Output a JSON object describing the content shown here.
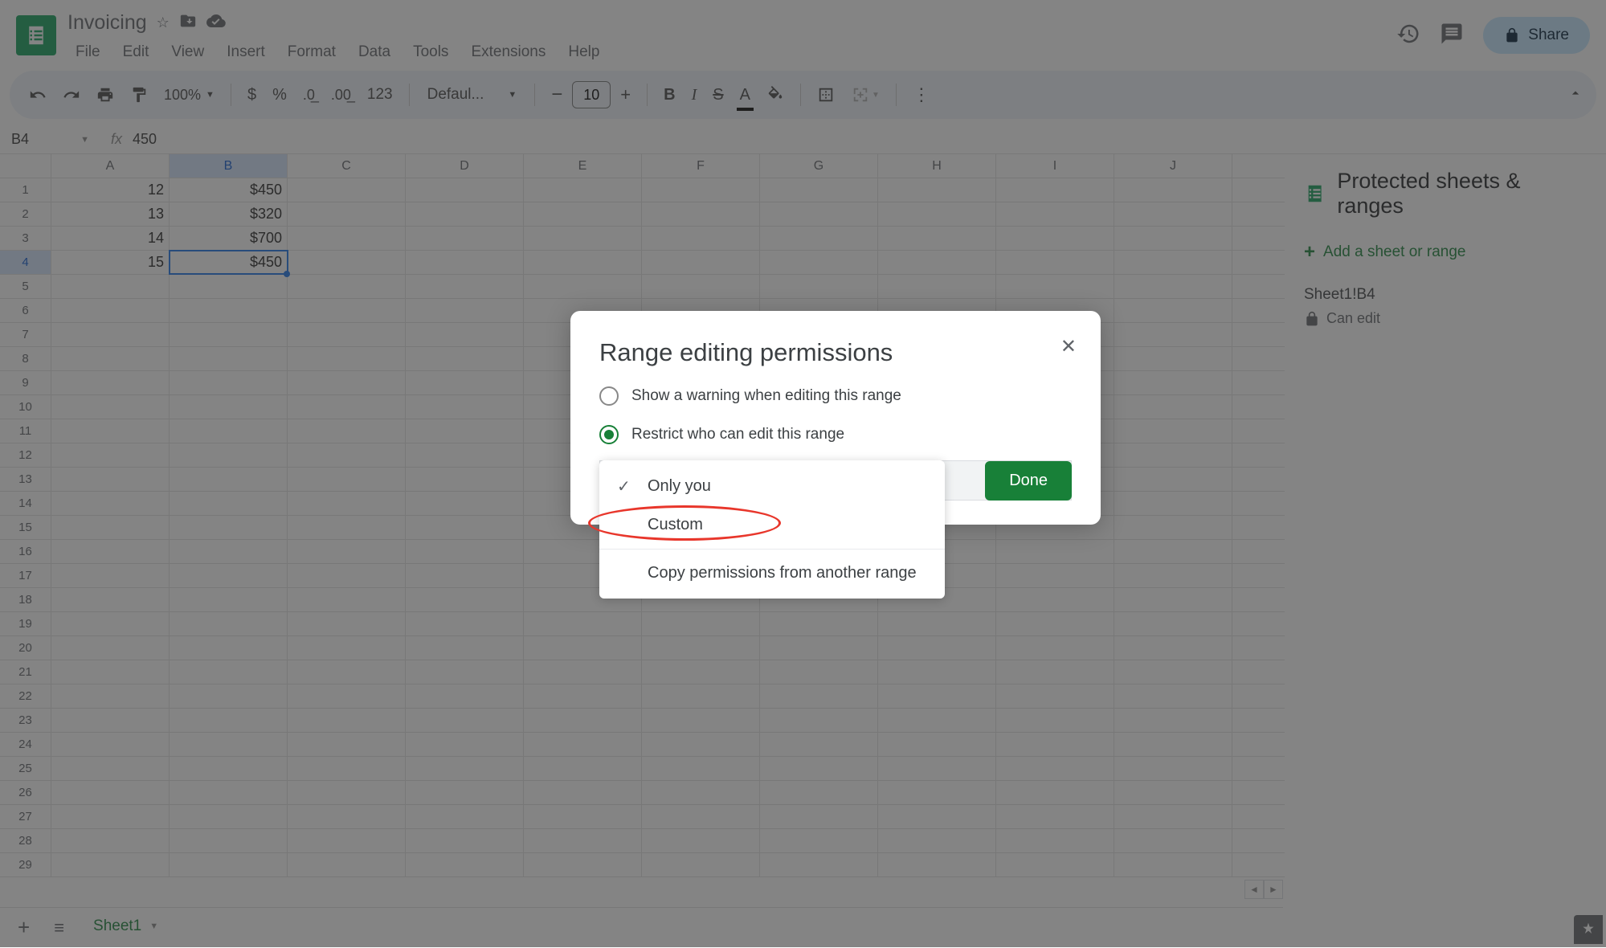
{
  "header": {
    "doc_title": "Invoicing",
    "menus": [
      "File",
      "Edit",
      "View",
      "Insert",
      "Format",
      "Data",
      "Tools",
      "Extensions",
      "Help"
    ],
    "share": "Share"
  },
  "toolbar": {
    "zoom": "100%",
    "font": "Defaul...",
    "font_size": "10",
    "number_format": "123"
  },
  "fx": {
    "name_box": "B4",
    "value": "450"
  },
  "grid": {
    "columns": [
      "A",
      "B",
      "C",
      "D",
      "E",
      "F",
      "G",
      "H",
      "I",
      "J"
    ],
    "rows": [
      {
        "n": 1,
        "a": "12",
        "b": "$450"
      },
      {
        "n": 2,
        "a": "13",
        "b": "$320"
      },
      {
        "n": 3,
        "a": "14",
        "b": "$700"
      },
      {
        "n": 4,
        "a": "15",
        "b": "$450",
        "sel": true
      },
      {
        "n": 5
      },
      {
        "n": 6
      },
      {
        "n": 7
      },
      {
        "n": 8
      },
      {
        "n": 9
      },
      {
        "n": 10
      },
      {
        "n": 11
      },
      {
        "n": 12
      },
      {
        "n": 13
      },
      {
        "n": 14
      },
      {
        "n": 15
      },
      {
        "n": 16
      },
      {
        "n": 17
      },
      {
        "n": 18
      },
      {
        "n": 19
      },
      {
        "n": 20
      },
      {
        "n": 21
      },
      {
        "n": 22
      },
      {
        "n": 23
      },
      {
        "n": 24
      },
      {
        "n": 25
      },
      {
        "n": 26
      },
      {
        "n": 27
      },
      {
        "n": 28
      },
      {
        "n": 29
      }
    ],
    "selected_col": "B",
    "selected_row": 4
  },
  "sidepanel": {
    "title": "Protected sheets & ranges",
    "add": "Add a sheet or range",
    "range_label": "Sheet1!B4",
    "perm": "Can edit"
  },
  "tabs": {
    "sheet1": "Sheet1"
  },
  "modal": {
    "title": "Range editing permissions",
    "opt_warning": "Show a warning when editing this range",
    "opt_restrict": "Restrict who can edit this range",
    "dd_only_you": "Only you",
    "dd_custom": "Custom",
    "dd_copy": "Copy permissions from another range",
    "done": "Done"
  }
}
